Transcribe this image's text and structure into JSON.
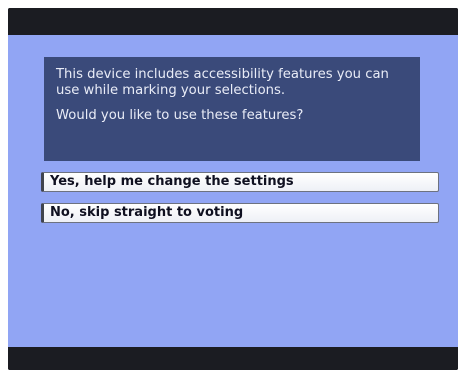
{
  "prompt": {
    "line1": "This device includes accessibility features you can use while marking your selections.",
    "line2": "Would you like to use these features?"
  },
  "choices": {
    "yes_label": "Yes, help me change the settings",
    "no_label": "No, skip straight to voting"
  },
  "colors": {
    "background": "#91a5f4",
    "info_box": "#3a4a7a",
    "bars": "#1b1c22"
  }
}
